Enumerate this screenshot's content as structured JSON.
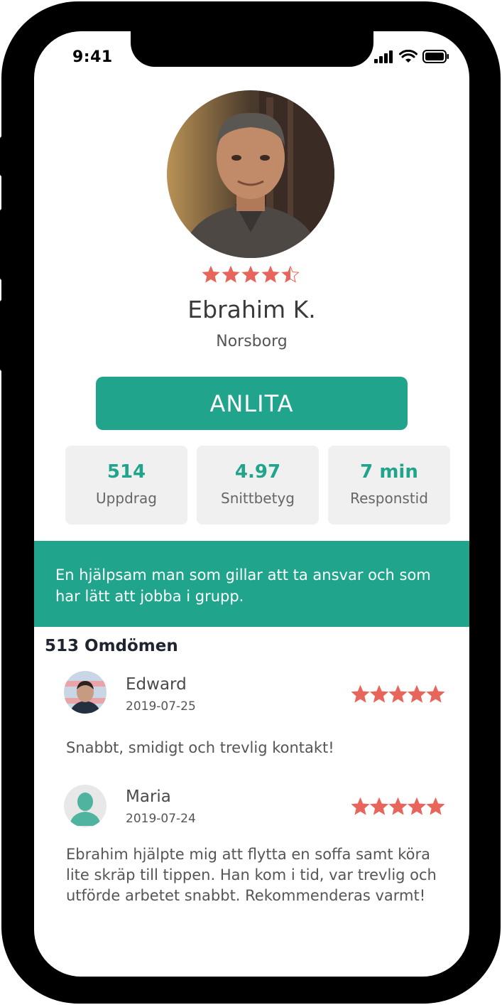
{
  "status_bar": {
    "time": "9:41"
  },
  "profile": {
    "rating": 4.5,
    "name": "Ebrahim K.",
    "location": "Norsborg",
    "hire_button": "ANLITA"
  },
  "stats": [
    {
      "value": "514",
      "label": "Uppdrag"
    },
    {
      "value": "4.97",
      "label": "Snittbetyg"
    },
    {
      "value": "7 min",
      "label": "Responstid"
    }
  ],
  "bio": "En hjälpsam man som gillar att ta ansvar och som har lätt att jobba i grupp.",
  "reviews_section": {
    "title": "513 Omdömen",
    "reviews": [
      {
        "name": "Edward",
        "date": "2019-07-25",
        "stars": 5,
        "text": "Snabbt, smidigt och trevlig kontakt!"
      },
      {
        "name": "Maria",
        "date": "2019-07-24",
        "stars": 5,
        "text": "Ebrahim hjälpte mig att flytta en soffa samt köra lite skräp till tippen. Han kom i tid, var trevlig och utförde arbetet snabbt. Rekommenderas varmt!"
      }
    ]
  },
  "colors": {
    "accent": "#20a58c",
    "star": "#e8655c"
  }
}
